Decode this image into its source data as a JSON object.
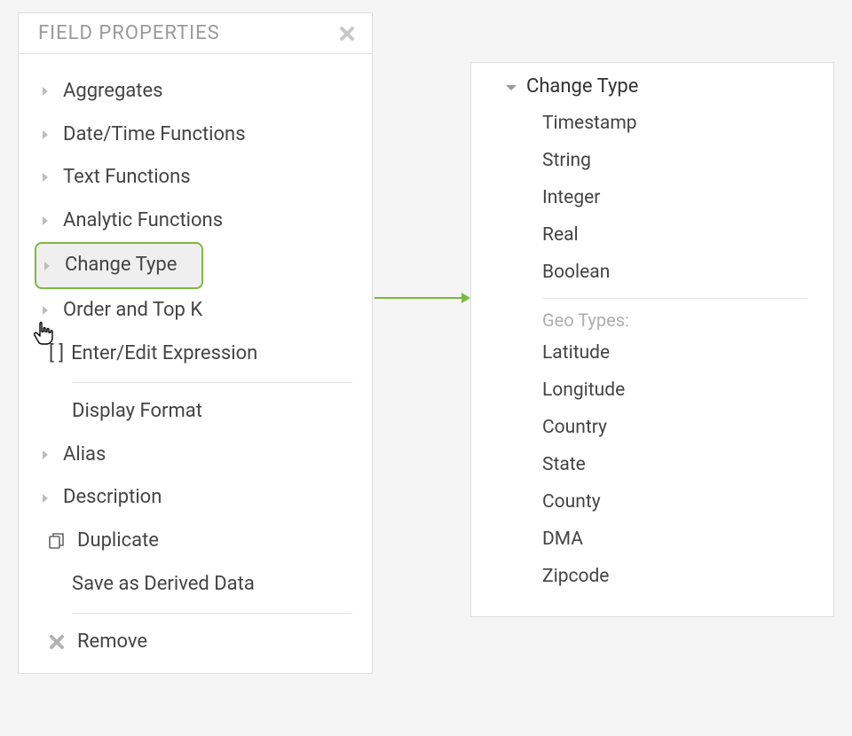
{
  "panel": {
    "title": "FIELD PROPERTIES",
    "items": {
      "aggregates": "Aggregates",
      "datetime": "Date/Time Functions",
      "text_fns": "Text Functions",
      "analytic": "Analytic Functions",
      "change_type": "Change Type",
      "order_topk": "Order and Top K",
      "enter_edit_expr": "Enter/Edit Expression",
      "display_format": "Display Format",
      "alias": "Alias",
      "description": "Description",
      "duplicate": "Duplicate",
      "save_derived": "Save as Derived Data",
      "remove": "Remove"
    },
    "brackets": "[ ]"
  },
  "submenu": {
    "title": "Change Type",
    "items": {
      "timestamp": "Timestamp",
      "string": "String",
      "integer": "Integer",
      "real": "Real",
      "boolean": "Boolean"
    },
    "geo_label": "Geo Types:",
    "geo_items": {
      "latitude": "Latitude",
      "longitude": "Longitude",
      "country": "Country",
      "state": "State",
      "county": "County",
      "dma": "DMA",
      "zipcode": "Zipcode"
    }
  }
}
